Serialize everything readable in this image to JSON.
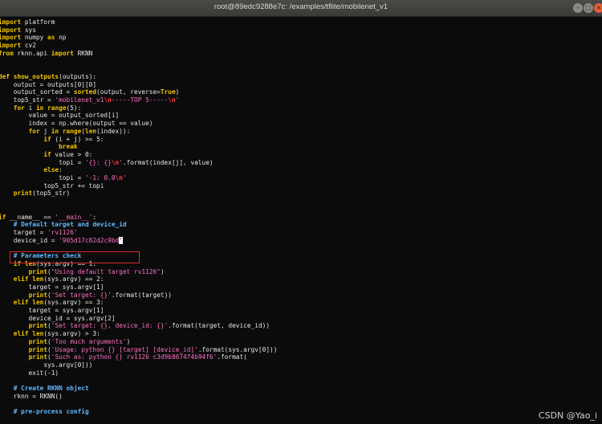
{
  "window": {
    "title": "root@89edc9288e7c: /examples/tflite/mobilenet_v1",
    "buttons": {
      "minimize": "–",
      "maximize": "□",
      "close": "×"
    }
  },
  "code_lines": [
    [
      [
        "kw",
        "import"
      ],
      [
        "t",
        " platform"
      ]
    ],
    [
      [
        "kw",
        "import"
      ],
      [
        "t",
        " sys"
      ]
    ],
    [
      [
        "kw",
        "import"
      ],
      [
        "t",
        " numpy "
      ],
      [
        "kw",
        "as"
      ],
      [
        "t",
        " np"
      ]
    ],
    [
      [
        "kw",
        "import"
      ],
      [
        "t",
        " cv2"
      ]
    ],
    [
      [
        "kw",
        "from"
      ],
      [
        "t",
        " rknn.api "
      ],
      [
        "kw",
        "import"
      ],
      [
        "t",
        " RKNN"
      ]
    ],
    [],
    [],
    [
      [
        "kw",
        "def"
      ],
      [
        "t",
        " "
      ],
      [
        "fn",
        "show_outputs"
      ],
      [
        "t",
        "(outputs):"
      ]
    ],
    [
      [
        "t",
        "    output = outputs[0][0]"
      ]
    ],
    [
      [
        "t",
        "    output_sorted = "
      ],
      [
        "fn",
        "sorted"
      ],
      [
        "t",
        "(output, reverse="
      ],
      [
        "kw",
        "True"
      ],
      [
        "t",
        ")"
      ]
    ],
    [
      [
        "t",
        "    top5_str = "
      ],
      [
        "str",
        "'mobilenet_v1"
      ],
      [
        "esc",
        "\\n"
      ],
      [
        "str",
        "-----TOP 5-----"
      ],
      [
        "esc",
        "\\n"
      ],
      [
        "str",
        "'"
      ]
    ],
    [
      [
        "t",
        "    "
      ],
      [
        "kw",
        "for"
      ],
      [
        "t",
        " i "
      ],
      [
        "kw",
        "in"
      ],
      [
        "t",
        " "
      ],
      [
        "fn",
        "range"
      ],
      [
        "t",
        "(5):"
      ]
    ],
    [
      [
        "t",
        "        value = output_sorted[i]"
      ]
    ],
    [
      [
        "t",
        "        index = np.where(output == value)"
      ]
    ],
    [
      [
        "t",
        "        "
      ],
      [
        "kw",
        "for"
      ],
      [
        "t",
        " j "
      ],
      [
        "kw",
        "in"
      ],
      [
        "t",
        " "
      ],
      [
        "fn",
        "range"
      ],
      [
        "t",
        "("
      ],
      [
        "fn",
        "len"
      ],
      [
        "t",
        "(index)):"
      ]
    ],
    [
      [
        "t",
        "            "
      ],
      [
        "kw",
        "if"
      ],
      [
        "t",
        " (i + j) >= 5:"
      ]
    ],
    [
      [
        "t",
        "                "
      ],
      [
        "kw",
        "break"
      ]
    ],
    [
      [
        "t",
        "            "
      ],
      [
        "kw",
        "if"
      ],
      [
        "t",
        " value > 0:"
      ]
    ],
    [
      [
        "t",
        "                topi = "
      ],
      [
        "str",
        "'{}: {}"
      ],
      [
        "esc",
        "\\n"
      ],
      [
        "str",
        "'"
      ],
      [
        "t",
        ".format(index[j], value)"
      ]
    ],
    [
      [
        "t",
        "            "
      ],
      [
        "kw",
        "else"
      ],
      [
        "t",
        ":"
      ]
    ],
    [
      [
        "t",
        "                topi = "
      ],
      [
        "str",
        "'-1: 0.0"
      ],
      [
        "esc",
        "\\n"
      ],
      [
        "str",
        "'"
      ]
    ],
    [
      [
        "t",
        "            top5_str += topi"
      ]
    ],
    [
      [
        "t",
        "    "
      ],
      [
        "fn",
        "print"
      ],
      [
        "t",
        "(top5_str)"
      ]
    ],
    [],
    [],
    [
      [
        "kw",
        "if"
      ],
      [
        "t",
        " __name__ == "
      ],
      [
        "str",
        "'__main__'"
      ],
      [
        "t",
        ":"
      ]
    ],
    [
      [
        "t",
        "    "
      ],
      [
        "cm",
        "# Default target and device_id"
      ]
    ],
    [
      [
        "t",
        "    target = "
      ],
      [
        "str",
        "'rv1126'"
      ]
    ],
    [
      [
        "t",
        "    device_id = "
      ],
      [
        "str",
        "'905d17c82d2c9bd"
      ],
      [
        "cursor",
        "'"
      ]
    ],
    [],
    [
      [
        "t",
        "    "
      ],
      [
        "cm",
        "# Parameters check"
      ]
    ],
    [
      [
        "t",
        "    "
      ],
      [
        "kw",
        "if"
      ],
      [
        "t",
        " "
      ],
      [
        "fn",
        "len"
      ],
      [
        "t",
        "(sys.argv) == 1:"
      ]
    ],
    [
      [
        "t",
        "        "
      ],
      [
        "fn",
        "print"
      ],
      [
        "t",
        "("
      ],
      [
        "str",
        "\"Using default target rv1126\""
      ],
      [
        "t",
        ")"
      ]
    ],
    [
      [
        "t",
        "    "
      ],
      [
        "kw",
        "elif"
      ],
      [
        "t",
        " "
      ],
      [
        "fn",
        "len"
      ],
      [
        "t",
        "(sys.argv) == 2:"
      ]
    ],
    [
      [
        "t",
        "        target = sys.argv[1]"
      ]
    ],
    [
      [
        "t",
        "        "
      ],
      [
        "fn",
        "print"
      ],
      [
        "t",
        "("
      ],
      [
        "str",
        "'Set target: {}'"
      ],
      [
        "t",
        ".format(target))"
      ]
    ],
    [
      [
        "t",
        "    "
      ],
      [
        "kw",
        "elif"
      ],
      [
        "t",
        " "
      ],
      [
        "fn",
        "len"
      ],
      [
        "t",
        "(sys.argv) == 3:"
      ]
    ],
    [
      [
        "t",
        "        target = sys.argv[1]"
      ]
    ],
    [
      [
        "t",
        "        device_id = sys.argv[2]"
      ]
    ],
    [
      [
        "t",
        "        "
      ],
      [
        "fn",
        "print"
      ],
      [
        "t",
        "("
      ],
      [
        "str",
        "'Set target: {}, device_id: {}'"
      ],
      [
        "t",
        ".format(target, device_id))"
      ]
    ],
    [
      [
        "t",
        "    "
      ],
      [
        "kw",
        "elif"
      ],
      [
        "t",
        " "
      ],
      [
        "fn",
        "len"
      ],
      [
        "t",
        "(sys.argv) > 3:"
      ]
    ],
    [
      [
        "t",
        "        "
      ],
      [
        "fn",
        "print"
      ],
      [
        "t",
        "("
      ],
      [
        "str",
        "'Too much arguments'"
      ],
      [
        "t",
        ")"
      ]
    ],
    [
      [
        "t",
        "        "
      ],
      [
        "fn",
        "print"
      ],
      [
        "t",
        "("
      ],
      [
        "str",
        "'Usage: python {} [target] [device_id]'"
      ],
      [
        "t",
        ".format(sys.argv[0]))"
      ]
    ],
    [
      [
        "t",
        "        "
      ],
      [
        "fn",
        "print"
      ],
      [
        "t",
        "("
      ],
      [
        "str",
        "'Such as: python {} rv1126 c3d9b8674f4b94f6'"
      ],
      [
        "t",
        ".format("
      ]
    ],
    [
      [
        "t",
        "            sys.argv[0]))"
      ]
    ],
    [
      [
        "t",
        "        exit(-1)"
      ]
    ],
    [],
    [
      [
        "t",
        "    "
      ],
      [
        "cm",
        "# Create RKNN object"
      ]
    ],
    [
      [
        "t",
        "    rknn = RKNN()"
      ]
    ],
    [],
    [
      [
        "t",
        "    "
      ],
      [
        "cm",
        "# pre-process config"
      ]
    ]
  ],
  "watermark": "CSDN @Yao_i"
}
